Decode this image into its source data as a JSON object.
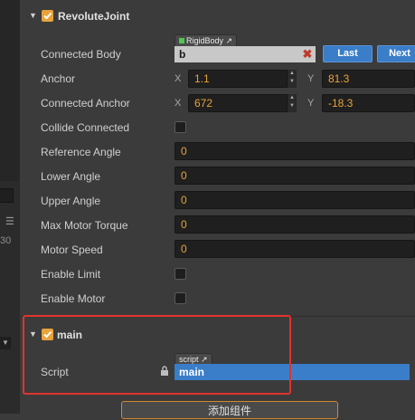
{
  "revolute_joint": {
    "title": "RevoluteJoint",
    "enabled": true,
    "connected_body": {
      "label": "Connected Body",
      "type_tag": "RigidBody",
      "value": "b",
      "last_button": "Last",
      "next_button": "Next"
    },
    "anchor": {
      "label": "Anchor",
      "x_axis": "X",
      "x": "1.1",
      "y_axis": "Y",
      "y": "81.3"
    },
    "connected_anchor": {
      "label": "Connected Anchor",
      "x_axis": "X",
      "x": "672",
      "y_axis": "Y",
      "y": "-18.3"
    },
    "collide_connected": {
      "label": "Collide Connected",
      "checked": false
    },
    "reference_angle": {
      "label": "Reference Angle",
      "value": "0"
    },
    "lower_angle": {
      "label": "Lower Angle",
      "value": "0"
    },
    "upper_angle": {
      "label": "Upper Angle",
      "value": "0"
    },
    "max_motor_torque": {
      "label": "Max Motor Torque",
      "value": "0"
    },
    "motor_speed": {
      "label": "Motor Speed",
      "value": "0"
    },
    "enable_limit": {
      "label": "Enable Limit",
      "checked": false
    },
    "enable_motor": {
      "label": "Enable Motor",
      "checked": false
    }
  },
  "main_component": {
    "title": "main",
    "enabled": true,
    "script": {
      "label": "Script",
      "type_tag": "script",
      "value": "main"
    }
  },
  "left_strip": {
    "number": "30"
  },
  "add_component_button": "添加组件",
  "colors": {
    "accent_orange": "#e8a33a",
    "button_blue": "#3a7dc8",
    "highlight_red": "#e0342c",
    "panel_bg": "#3b3b3b"
  }
}
